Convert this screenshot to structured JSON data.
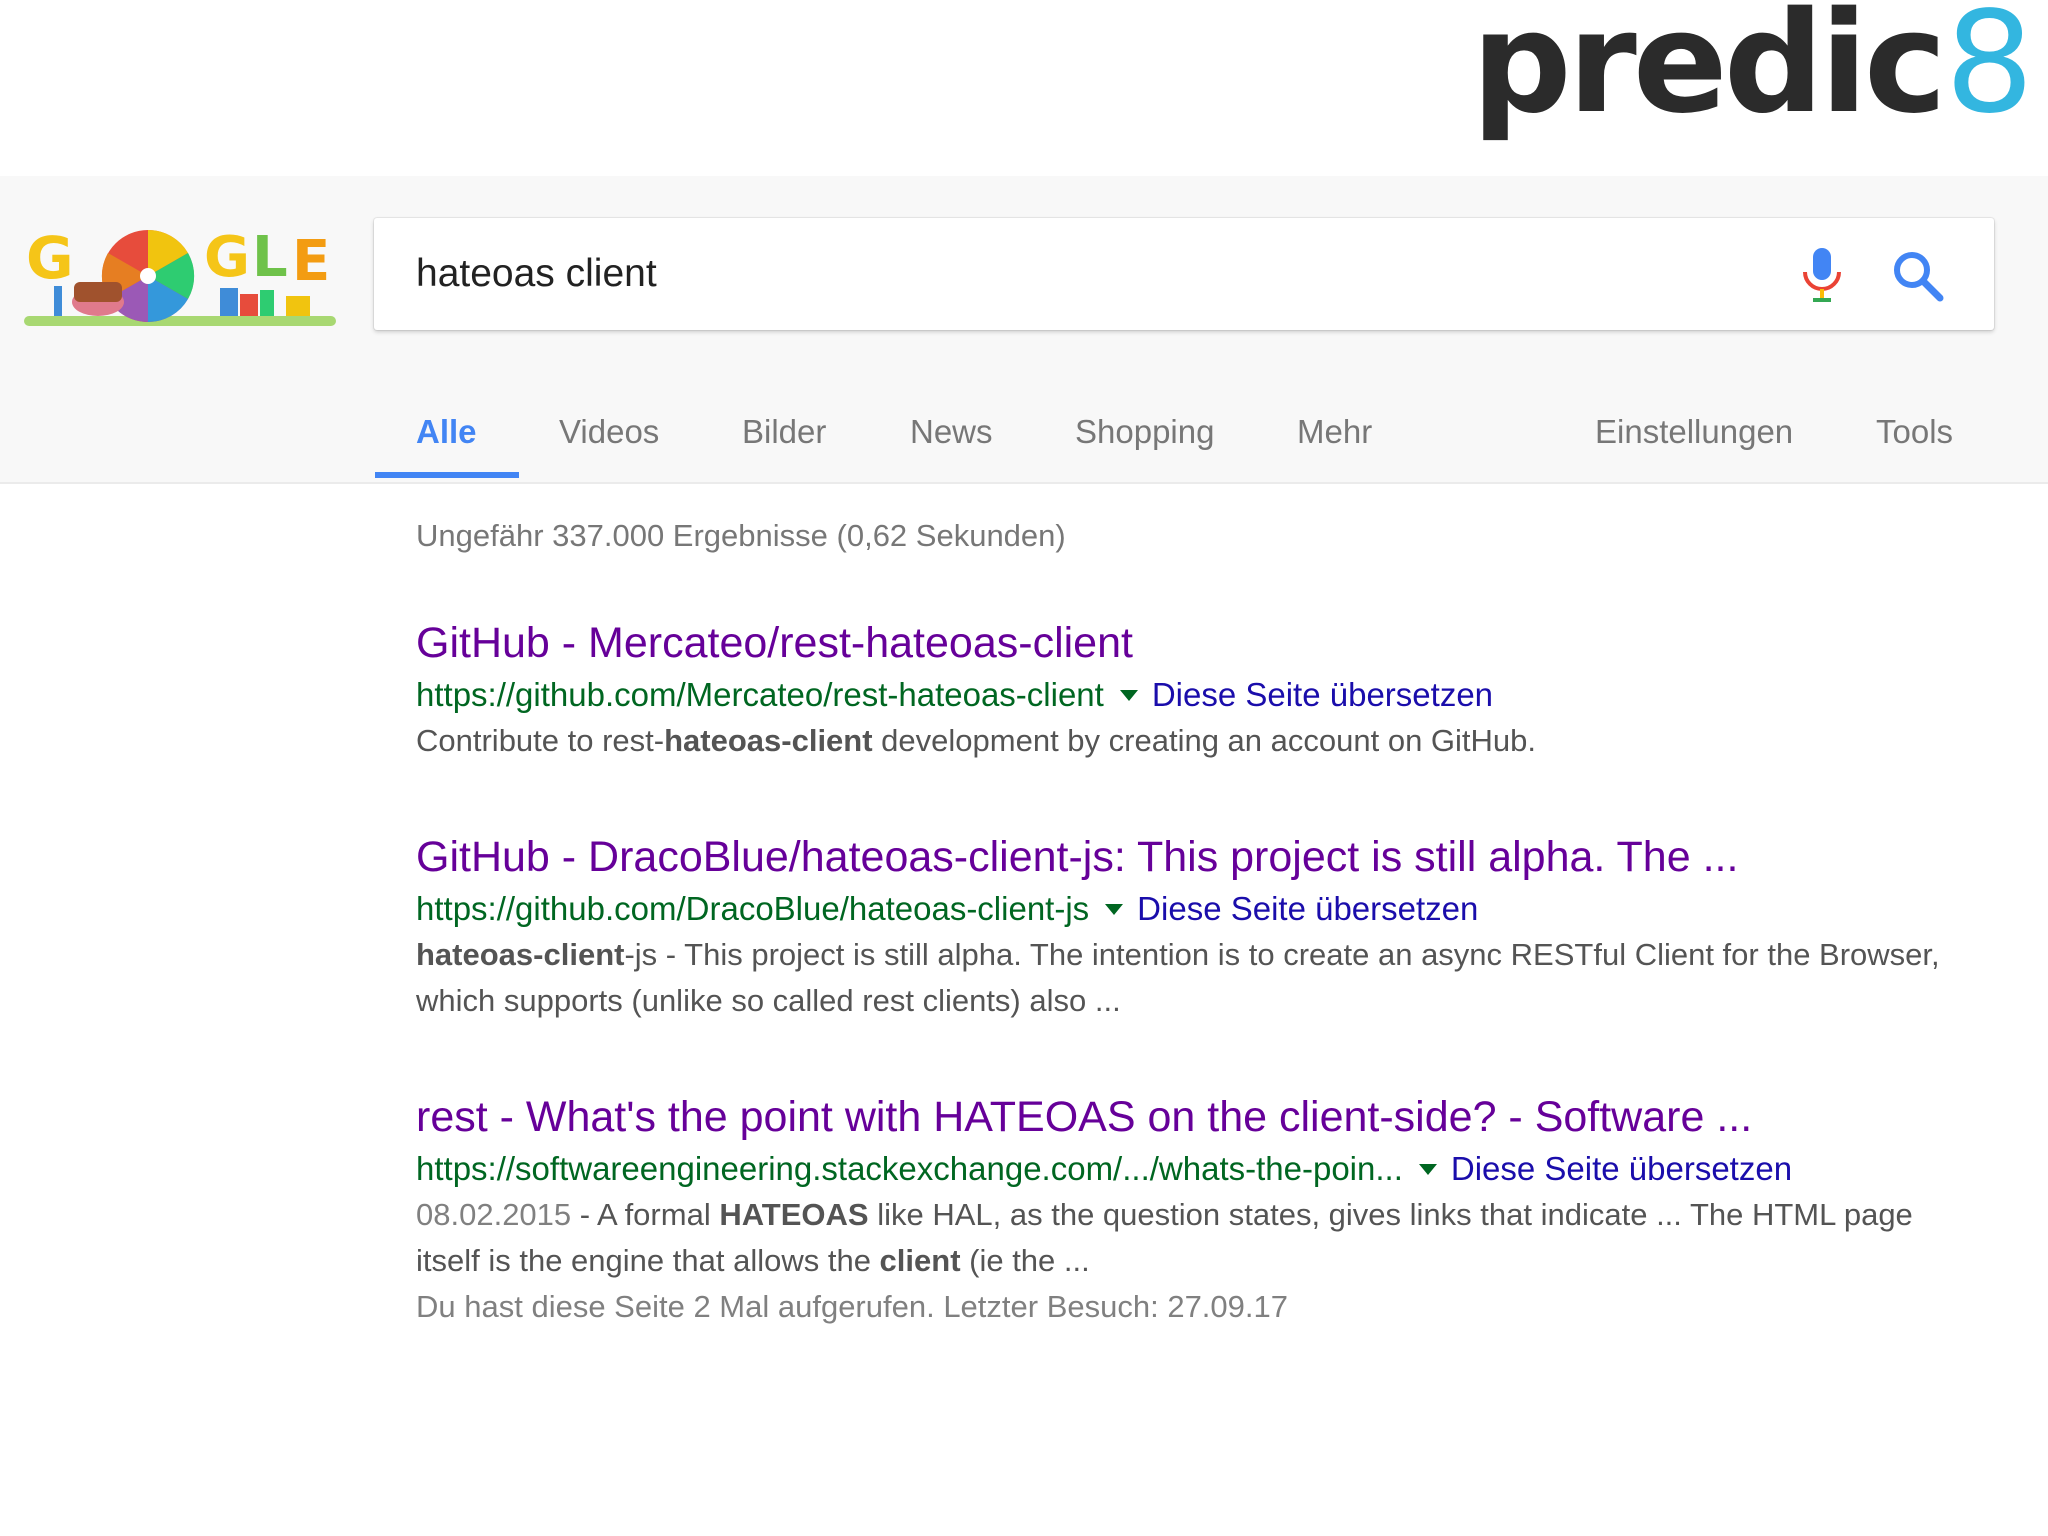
{
  "brand": {
    "logo_main": "predic",
    "logo_digit": "8"
  },
  "doodle": {
    "icon": "google-doodle-birthday"
  },
  "search": {
    "query": "hateoas client",
    "mic_icon": "microphone-icon",
    "search_icon": "magnifier-icon"
  },
  "tabs": [
    {
      "label": "Alle",
      "active": true
    },
    {
      "label": "Videos"
    },
    {
      "label": "Bilder"
    },
    {
      "label": "News"
    },
    {
      "label": "Shopping"
    },
    {
      "label": "Mehr"
    },
    {
      "label": "Einstellungen"
    },
    {
      "label": "Tools"
    }
  ],
  "stats": "Ungefähr 337.000 Ergebnisse (0,62 Sekunden)",
  "results": [
    {
      "title": "GitHub - Mercateo/rest-hateoas-client",
      "url": "https://github.com/Mercateo/rest-hateoas-client",
      "translate": "Diese Seite übersetzen",
      "snippet": {
        "s1": "Contribute to rest-",
        "b1": "hateoas-client",
        "s2": " development by creating an account on GitHub."
      }
    },
    {
      "title": "GitHub - DracoBlue/hateoas-client-js: This project is still alpha. The ...",
      "url": "https://github.com/DracoBlue/hateoas-client-js",
      "translate": "Diese Seite übersetzen",
      "snippet": {
        "b1": "hateoas-client",
        "s1": "-js - This project is still alpha. The intention is to create an async RESTful Client for the Browser, which supports (unlike so called rest clients) also ..."
      }
    },
    {
      "title": "rest - What's the point with HATEOAS on the client-side? - Software ...",
      "url": "https://softwareengineering.stackexchange.com/.../whats-the-poin...",
      "translate": "Diese Seite übersetzen",
      "snippet": {
        "date": "08.02.2015",
        "s1": " - A formal ",
        "b1": "HATEOAS",
        "s2": " like HAL, as the question states, gives links that indicate ... The HTML page itself is the engine that allows the ",
        "b2": "client",
        "s3": " (ie the ..."
      },
      "visited": "Du hast diese Seite 2 Mal aufgerufen. Letzter Besuch: 27.09.17"
    }
  ]
}
